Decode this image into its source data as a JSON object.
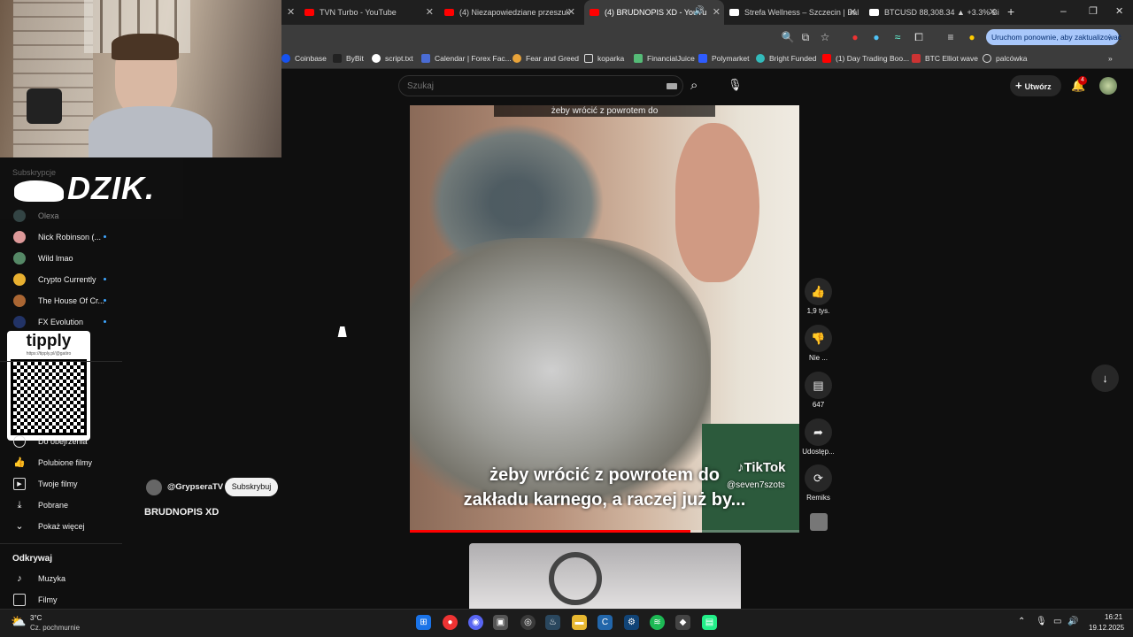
{
  "tabs": [
    {
      "label": "TVN Turbo - YouTube"
    },
    {
      "label": "(4) Niezapowiedziane przeszuk"
    },
    {
      "label": "(4) BRUDNOPIS XD - YouTu"
    },
    {
      "label": "Strefa Wellness – Szczecin | Bal"
    },
    {
      "label": "BTCUSD 88,308.34 ▲ +3.3% Bi"
    }
  ],
  "update_button": "Uruchom ponownie, aby zaktualizować",
  "bookmarks": [
    "Coinbase",
    "ByBit",
    "script.txt",
    "Calendar | Forex Fac...",
    "Fear and Greed",
    "koparka",
    "FinancialJuice",
    "Polymarket",
    "Bright Funded",
    "(1) Day Trading Boo...",
    "BTC Elliot wave",
    "palcówka"
  ],
  "search": {
    "placeholder": "Szukaj"
  },
  "header": {
    "create_label": "Utwórz",
    "notifications_count": "4"
  },
  "overlay": {
    "sub_label": "Subskrypcje",
    "brand": "DZIK.",
    "tipply_label": "tipply",
    "tipply_url": "https://tipply.pl/@gatiro"
  },
  "sidebar": {
    "subs": [
      {
        "label": "Olexa"
      },
      {
        "label": "Nick Robinson (..."
      },
      {
        "label": "Wild lmao"
      },
      {
        "label": "Crypto Currently"
      },
      {
        "label": "The House Of Cr..."
      },
      {
        "label": "FX Evolution"
      }
    ],
    "you": [
      {
        "label": "Do obejrzenia"
      },
      {
        "label": "Polubione filmy"
      },
      {
        "label": "Twoje filmy"
      },
      {
        "label": "Pobrane"
      },
      {
        "label": "Pokaż więcej"
      }
    ],
    "explore_title": "Odkrywaj",
    "explore": [
      {
        "label": "Muzyka"
      },
      {
        "label": "Filmy"
      }
    ]
  },
  "short": {
    "top_caption": "żeby wrócić z powrotem do",
    "caption_line1": "żeby wrócić z powrotem do",
    "caption_line2": "zakładu karnego, a raczej już by...",
    "tiktok_label": "TikTok",
    "tiktok_user": "@seven7szots",
    "channel": "@GrypseraTV",
    "subscribe_label": "Subskrybuj",
    "title": "BRUDNOPIS XD",
    "progress": 0.72
  },
  "actions": {
    "likes": "1,9 tys.",
    "dislike": "Nie ...",
    "comments": "647",
    "share": "Udostęp...",
    "remix": "Remiks"
  },
  "taskbar": {
    "temp": "3°C",
    "weather": "Cz. pochmurnie",
    "time": "16:21",
    "date": "19.12.2025"
  }
}
